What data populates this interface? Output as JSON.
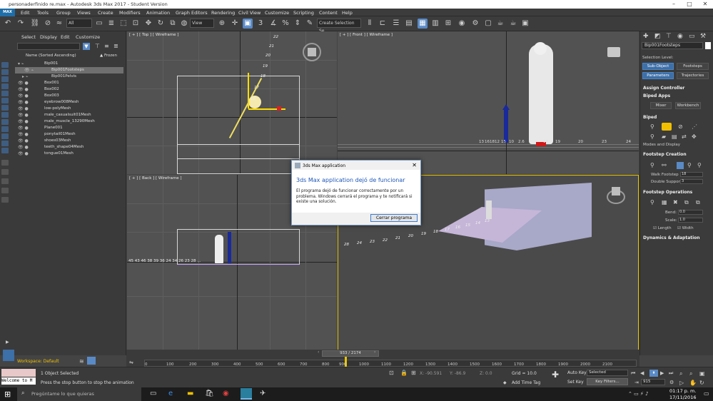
{
  "window": {
    "title": "personaderfinido re.max - Autodesk 3ds Max 2017 - Student Version",
    "logo": "MAX"
  },
  "menu": [
    "Edit",
    "Tools",
    "Group",
    "Views",
    "Create",
    "Modifiers",
    "Animation",
    "Graph Editors",
    "Rendering",
    "Civil View",
    "Customize",
    "Scripting",
    "Content",
    "Help"
  ],
  "toolbar": {
    "filter": "All",
    "refcoord": "View",
    "selset": "Create Selection Se"
  },
  "scene_explorer": {
    "tabs": [
      "Select",
      "Display",
      "Edit",
      "Customize"
    ],
    "col_name": "Name (Sorted Ascending)",
    "col_frozen": "▲ Frozen",
    "rows": [
      "Bip001",
      "Bip001Footsteps",
      "Bip001Pelvis",
      "Box001",
      "Box002",
      "Box003",
      "eyebrow008Mesh",
      "low-polyMesh",
      "male_casualsuit01Mesh",
      "male_muscle_13290Mesh",
      "Plane001",
      "ponytail01Mesh",
      "shoes03Mesh",
      "teeth_shape04Mesh",
      "tongue01Mesh"
    ],
    "workspace": "Workspace: Default"
  },
  "viewports": {
    "top": "[ + ] [ Top ] [ Wireframe ]",
    "front": "[ + ] [ Front ] [ Wireframe ]",
    "back": "[ + ] [ Back ] [ Wireframe ]"
  },
  "front_ticks": [
    "13",
    "16",
    "18",
    "12",
    "15",
    "10",
    "2.6",
    "17",
    "19",
    "20",
    "23",
    "24"
  ],
  "top_ticks": [
    "22",
    "21",
    "20",
    "19",
    "18",
    "17",
    "16"
  ],
  "back_ticks": "45 43 46 38 39 36 24 34 26 23 28 ...",
  "persp_ticks": [
    "28",
    "24",
    "23",
    "22",
    "21",
    "20",
    "19",
    "18",
    "17",
    "16",
    "15",
    "14",
    "13"
  ],
  "cmd": {
    "object": "Bip001Footsteps",
    "sel_level": "Selection Level:",
    "sub_object": "Sub-Object",
    "footsteps": "Footsteps",
    "parameters": "Parameters",
    "trajectories": "Trajectories",
    "assign": "Assign Controller",
    "biped_apps": "Biped Apps",
    "mixer": "Mixer",
    "workbench": "Workbench",
    "biped": "Biped",
    "modes": "Modes and Display",
    "fs_creation": "Footstep Creation",
    "walk_fs": "Walk Footstep",
    "walk_val": "18",
    "double_sup": "Double Support",
    "double_val": "3",
    "fs_ops": "Footstep Operations",
    "bend": "Bend:",
    "bend_val": "0.0",
    "scale": "Scale:",
    "scale_val": "1.0",
    "length": "Length",
    "width": "Width",
    "dyn": "Dynamics & Adaptation"
  },
  "dialog": {
    "title": "3ds Max application",
    "heading": "3ds Max application dejó de funcionar",
    "message": "El programa dejó de funcionar correctamente por un problema. Windows cerrará el programa y te notificará si existe una solución.",
    "button": "Cerrar programa"
  },
  "timeline": {
    "frame": "933 / 2174",
    "ticks": [
      "0",
      "100",
      "200",
      "300",
      "400",
      "500",
      "600",
      "700",
      "800",
      "900",
      "1000",
      "1100",
      "1200",
      "1300",
      "1400",
      "1500",
      "1600",
      "1700",
      "1800",
      "1900",
      "2000",
      "2100"
    ]
  },
  "status": {
    "listener": "Welcome to M",
    "selected": "1 Object Selected",
    "prompt": "Press the stop button to stop the animation",
    "x": "X: -90.591",
    "y": "Y: -86.9",
    "z": "Z: 0.0",
    "grid": "Grid = 10.0",
    "autokey": "Auto Key",
    "setkey": "Set Key",
    "keymode": "Selected",
    "keyfilters": "Key Filters...",
    "addtime": "Add Time Tag",
    "frame": "915"
  },
  "taskbar": {
    "search": "Pregúntame lo que quieras",
    "time": "01:17 p. m.",
    "date": "17/11/2016"
  }
}
